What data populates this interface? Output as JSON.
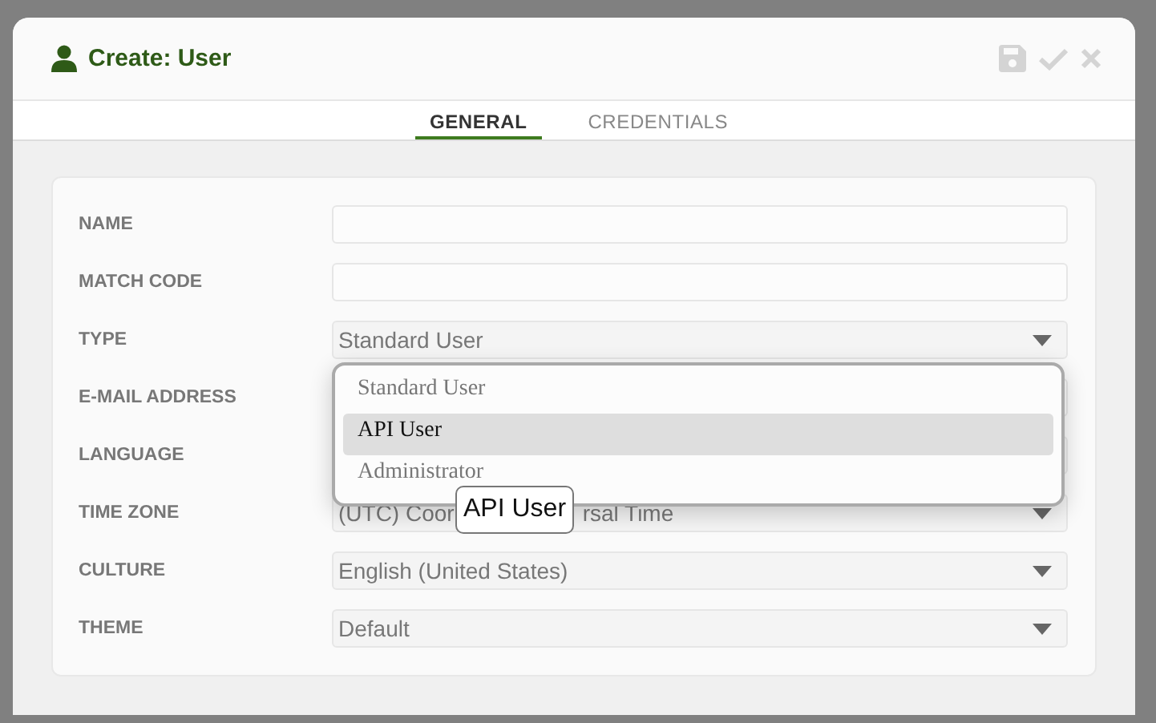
{
  "dialog": {
    "title": "Create: User"
  },
  "tabs": [
    {
      "label": "GENERAL",
      "selected": true
    },
    {
      "label": "CREDENTIALS",
      "selected": false
    }
  ],
  "fields": [
    {
      "label": "NAME",
      "kind": "text"
    },
    {
      "label": "MATCH CODE",
      "kind": "text"
    },
    {
      "label": "TYPE",
      "kind": "select",
      "value": "Standard User",
      "expanded": true
    },
    {
      "label": "E-MAIL ADDRESS",
      "kind": "text"
    },
    {
      "label": "LANGUAGE",
      "kind": "select"
    },
    {
      "label": "TIME ZONE",
      "kind": "select",
      "value_parts": [
        "(UTC) Coor",
        "rsal Time"
      ]
    },
    {
      "label": "CULTURE",
      "kind": "select",
      "value": "English (United States)"
    },
    {
      "label": "THEME",
      "kind": "select",
      "value": "Default"
    }
  ],
  "dropdown": {
    "options": [
      {
        "label": "Standard User",
        "selected": false
      },
      {
        "label": "API User",
        "selected": true
      },
      {
        "label": "Administrator",
        "selected": false
      }
    ]
  },
  "tooltip": {
    "text": "API User"
  }
}
